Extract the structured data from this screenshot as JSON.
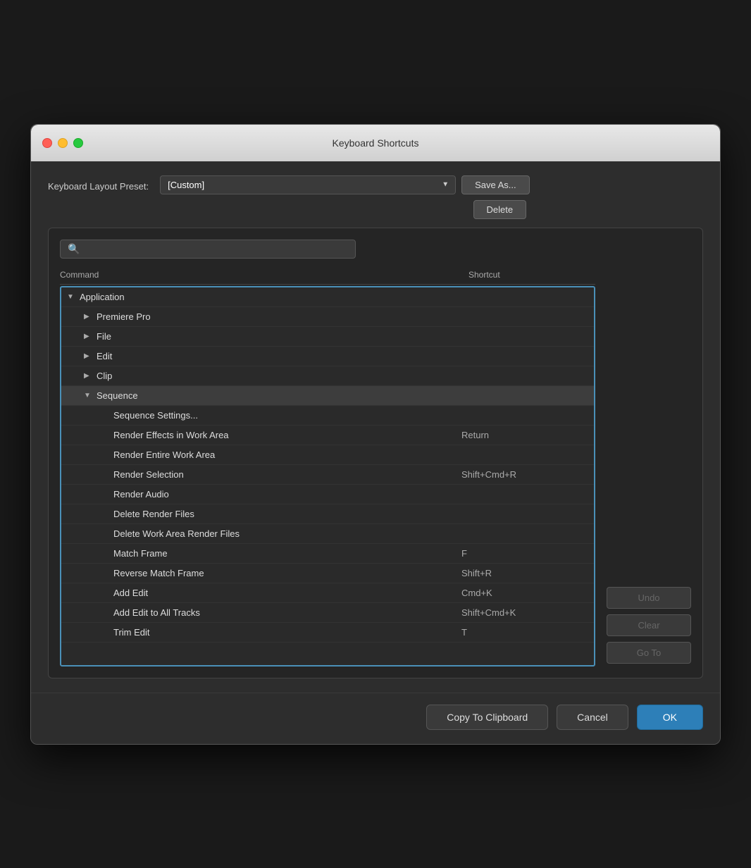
{
  "window": {
    "title": "Keyboard Shortcuts",
    "controls": {
      "close": "close",
      "minimize": "minimize",
      "maximize": "maximize"
    }
  },
  "preset": {
    "label": "Keyboard Layout Preset:",
    "value": "[Custom]",
    "save_as_label": "Save As...",
    "delete_label": "Delete"
  },
  "search": {
    "placeholder": ""
  },
  "table": {
    "col_command": "Command",
    "col_shortcut": "Shortcut"
  },
  "tree": [
    {
      "id": "application",
      "label": "Application",
      "indent": "indent-1",
      "arrow": "▼",
      "shortcut": "",
      "selected": false
    },
    {
      "id": "premiere-pro",
      "label": "Premiere Pro",
      "indent": "indent-2",
      "arrow": "▶",
      "shortcut": "",
      "selected": false
    },
    {
      "id": "file",
      "label": "File",
      "indent": "indent-2",
      "arrow": "▶",
      "shortcut": "",
      "selected": false
    },
    {
      "id": "edit",
      "label": "Edit",
      "indent": "indent-2",
      "arrow": "▶",
      "shortcut": "",
      "selected": false
    },
    {
      "id": "clip",
      "label": "Clip",
      "indent": "indent-2",
      "arrow": "▶",
      "shortcut": "",
      "selected": false
    },
    {
      "id": "sequence",
      "label": "Sequence",
      "indent": "indent-2",
      "arrow": "▼",
      "shortcut": "",
      "selected": true
    },
    {
      "id": "sequence-settings",
      "label": "Sequence Settings...",
      "indent": "indent-3",
      "arrow": "",
      "shortcut": "",
      "selected": false
    },
    {
      "id": "render-effects",
      "label": "Render Effects in Work Area",
      "indent": "indent-3",
      "arrow": "",
      "shortcut": "Return",
      "selected": false
    },
    {
      "id": "render-entire",
      "label": "Render Entire Work Area",
      "indent": "indent-3",
      "arrow": "",
      "shortcut": "",
      "selected": false
    },
    {
      "id": "render-selection",
      "label": "Render Selection",
      "indent": "indent-3",
      "arrow": "",
      "shortcut": "Shift+Cmd+R",
      "selected": false
    },
    {
      "id": "render-audio",
      "label": "Render Audio",
      "indent": "indent-3",
      "arrow": "",
      "shortcut": "",
      "selected": false
    },
    {
      "id": "delete-render-files",
      "label": "Delete Render Files",
      "indent": "indent-3",
      "arrow": "",
      "shortcut": "",
      "selected": false
    },
    {
      "id": "delete-work-area",
      "label": "Delete Work Area Render Files",
      "indent": "indent-3",
      "arrow": "",
      "shortcut": "",
      "selected": false
    },
    {
      "id": "match-frame",
      "label": "Match Frame",
      "indent": "indent-3",
      "arrow": "",
      "shortcut": "F",
      "selected": false
    },
    {
      "id": "reverse-match",
      "label": "Reverse Match Frame",
      "indent": "indent-3",
      "arrow": "",
      "shortcut": "Shift+R",
      "selected": false
    },
    {
      "id": "add-edit",
      "label": "Add Edit",
      "indent": "indent-3",
      "arrow": "",
      "shortcut": "Cmd+K",
      "selected": false
    },
    {
      "id": "add-edit-all",
      "label": "Add Edit to All Tracks",
      "indent": "indent-3",
      "arrow": "",
      "shortcut": "Shift+Cmd+K",
      "selected": false
    },
    {
      "id": "trim-edit",
      "label": "Trim Edit",
      "indent": "indent-3",
      "arrow": "",
      "shortcut": "T",
      "selected": false
    }
  ],
  "side_buttons": {
    "undo": "Undo",
    "clear": "Clear",
    "go_to": "Go To"
  },
  "footer": {
    "copy_to_clipboard": "Copy To Clipboard",
    "cancel": "Cancel",
    "ok": "OK"
  }
}
